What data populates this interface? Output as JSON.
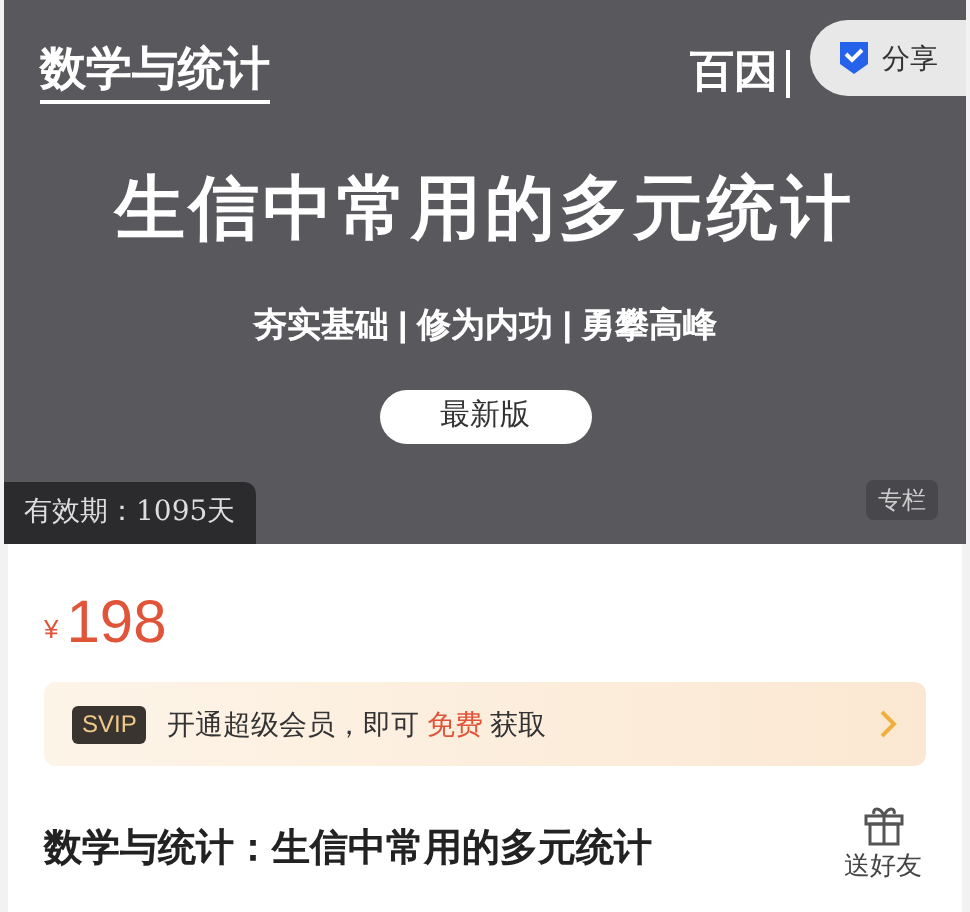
{
  "cover": {
    "brand": "数学与统计",
    "logo_text": "百因",
    "headline": "生信中常用的多元统计",
    "slogan": "夯实基础 | 修为内功 | 勇攀高峰",
    "edition": "最新版",
    "validity": "有效期：1095天",
    "type_tag": "专栏"
  },
  "share": {
    "label": "分享"
  },
  "price": {
    "currency": "¥",
    "amount": "198"
  },
  "svip": {
    "badge": "SVIP",
    "text_before": "开通超级会员，即可",
    "highlight": "免费",
    "text_after": "获取"
  },
  "title": "数学与统计：生信中常用的多元统计",
  "gift": {
    "label": "送好友"
  }
}
